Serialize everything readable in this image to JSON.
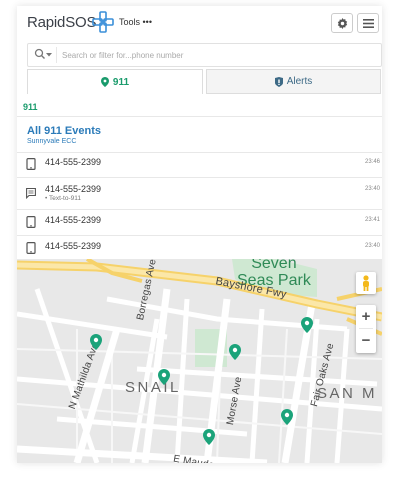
{
  "header": {
    "logo_text": "RapidSOS",
    "tools_label": "Tools",
    "tools_more": "•••"
  },
  "search": {
    "placeholder": "Search or filter for...phone number"
  },
  "tabs": [
    {
      "label": "911",
      "icon": "map-pin-icon",
      "active": true
    },
    {
      "label": "Alerts",
      "icon": "shield-icon",
      "active": false
    }
  ],
  "section_label": "911",
  "events": {
    "title": "All 911 Events",
    "subtitle": "Sunnyvale ECC"
  },
  "calls": [
    {
      "number": "414-555-2399",
      "sub": "",
      "time": "23:46",
      "icon": "phone-icon"
    },
    {
      "number": "414-555-2399",
      "sub": "• Text-to-911",
      "time": "23:40",
      "icon": "chat-icon"
    },
    {
      "number": "414-555-2399",
      "sub": "",
      "time": "23:41",
      "icon": "phone-icon"
    },
    {
      "number": "414-555-2399",
      "sub": "",
      "time": "23:40",
      "icon": "phone-icon"
    }
  ],
  "map": {
    "park_line1": "Seven",
    "park_line2": "Seas Park",
    "freeway": "Bayshore Fwy",
    "streets": [
      "Borregas Ave",
      "N Mathilda Ave",
      "Morse Ave",
      "Fair Oaks Ave",
      "E Maude"
    ],
    "areas": [
      "SNAIL",
      "SAN M"
    ],
    "zoom_in": "+",
    "zoom_out": "−"
  },
  "colors": {
    "accent_green": "#1a9b6c",
    "link_blue": "#2b7bb9",
    "freeway_yellow": "#f8d878"
  }
}
